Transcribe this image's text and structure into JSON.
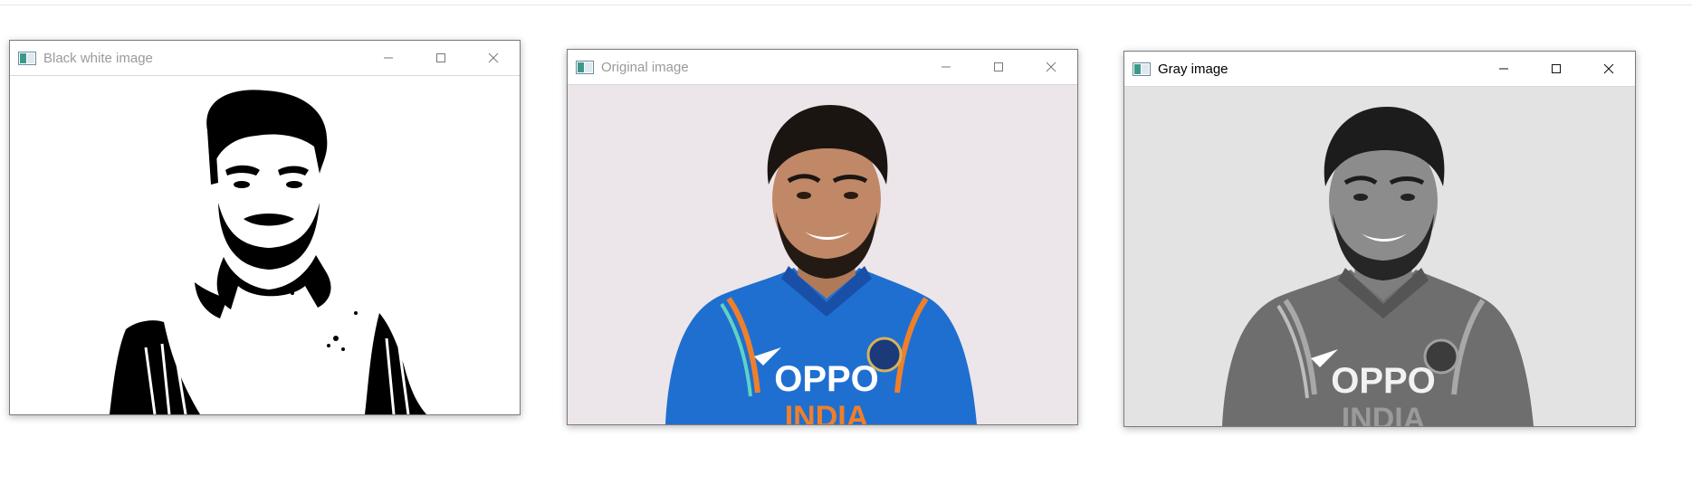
{
  "windows": [
    {
      "id": "bw",
      "title": "Black white image",
      "active": false,
      "render_mode": "black-white",
      "background_color": "#ffffff"
    },
    {
      "id": "orig",
      "title": "Original image",
      "active": false,
      "render_mode": "color",
      "background_color": "#ece6ea",
      "jersey_color": "#1f6fd0",
      "jersey_accent": "#f07f2a"
    },
    {
      "id": "gray",
      "title": "Gray image",
      "active": true,
      "render_mode": "grayscale",
      "background_color": "#e3e3e3"
    }
  ],
  "jersey_text": {
    "sponsor": "OPPO",
    "team": "INDIA"
  },
  "icons": {
    "app": "opencv-window-icon",
    "minimize": "minimize-icon",
    "maximize": "maximize-icon",
    "close": "close-icon"
  }
}
